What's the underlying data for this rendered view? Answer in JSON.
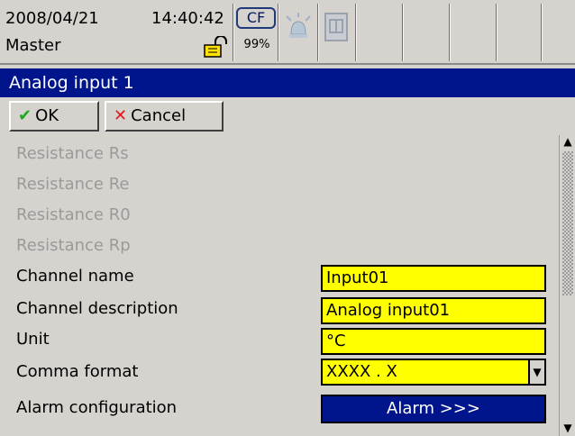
{
  "status": {
    "date": "2008/04/21",
    "time": "14:40:42",
    "user": "Master",
    "cf_label": "CF",
    "cf_percent": "99%",
    "icons": [
      "lock-icon",
      "cf-card-icon",
      "alarm-bell-icon",
      "document-icon"
    ]
  },
  "title": "Analog input 1",
  "toolbar": {
    "ok_label": "OK",
    "cancel_label": "Cancel"
  },
  "form": {
    "disabled_rows": [
      "Resistance Rs",
      "Resistance Re",
      "Resistance R0",
      "Resistance Rp"
    ],
    "channel_name_label": "Channel name",
    "channel_name_value": "Input01",
    "channel_description_label": "Channel description",
    "channel_description_value": "Analog input01",
    "unit_label": "Unit",
    "unit_value": "°C",
    "comma_format_label": "Comma format",
    "comma_format_value": "XXXX . X",
    "alarm_configuration_label": "Alarm configuration",
    "alarm_button_label": "Alarm >>>"
  },
  "colors": {
    "title_bar": "#00148c",
    "field_bg": "#ffff00",
    "panel_bg": "#d6d3ce",
    "disabled_text": "#9a9a9a"
  }
}
